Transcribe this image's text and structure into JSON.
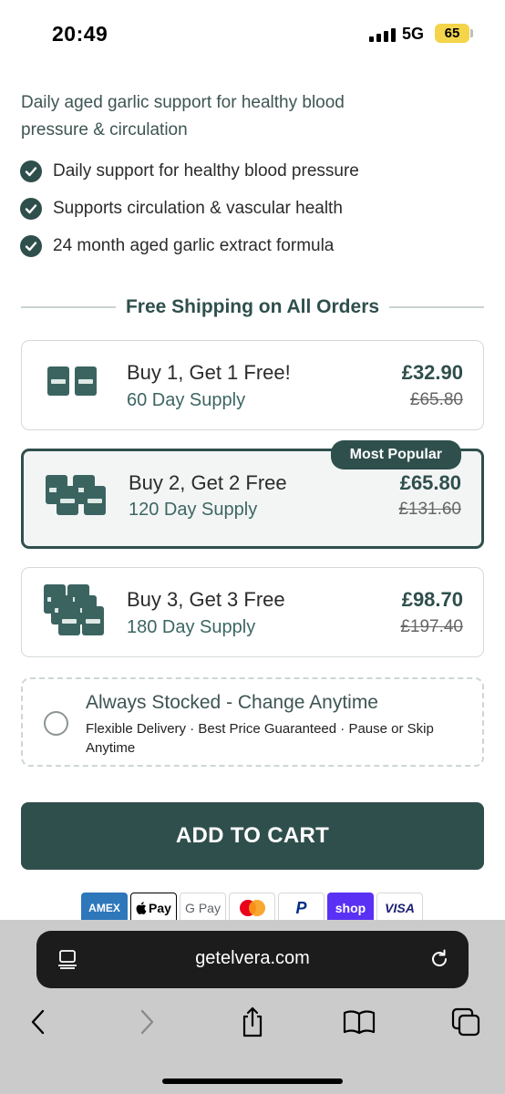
{
  "status_bar": {
    "time": "20:49",
    "network": "5G",
    "battery": "65"
  },
  "product": {
    "description": "Daily aged garlic support for healthy blood pressure & circulation",
    "benefits": [
      "Daily support for healthy blood pressure",
      "Supports circulation & vascular health",
      "24 month aged garlic extract formula"
    ]
  },
  "shipping_banner": "Free Shipping on All Orders",
  "offers": [
    {
      "title": "Buy 1, Get 1 Free!",
      "supply": "60 Day Supply",
      "price": "£32.90",
      "old_price": "£65.80",
      "selected": false
    },
    {
      "title": "Buy 2, Get 2 Free",
      "supply": "120 Day Supply",
      "price": "£65.80",
      "old_price": "£131.60",
      "selected": true,
      "badge": "Most Popular"
    },
    {
      "title": "Buy 3, Get 3 Free",
      "supply": "180 Day Supply",
      "price": "£98.70",
      "old_price": "£197.40",
      "selected": false
    }
  ],
  "subscription": {
    "title": "Always Stocked - Change Anytime",
    "description": "Flexible Delivery · Best Price Guaranteed · Pause or Skip Anytime",
    "checked": false
  },
  "add_to_cart": "ADD TO CART",
  "payment_methods": [
    "AMEX",
    "Pay",
    "G Pay",
    "",
    "P",
    "shop",
    "VISA"
  ],
  "browser": {
    "url": "getelvera.com"
  },
  "colors": {
    "brand": "#2f4f4c",
    "badge_bg": "#2f4f4c",
    "battery": "#f4d44a",
    "browser_chrome": "#cbcbcb"
  }
}
